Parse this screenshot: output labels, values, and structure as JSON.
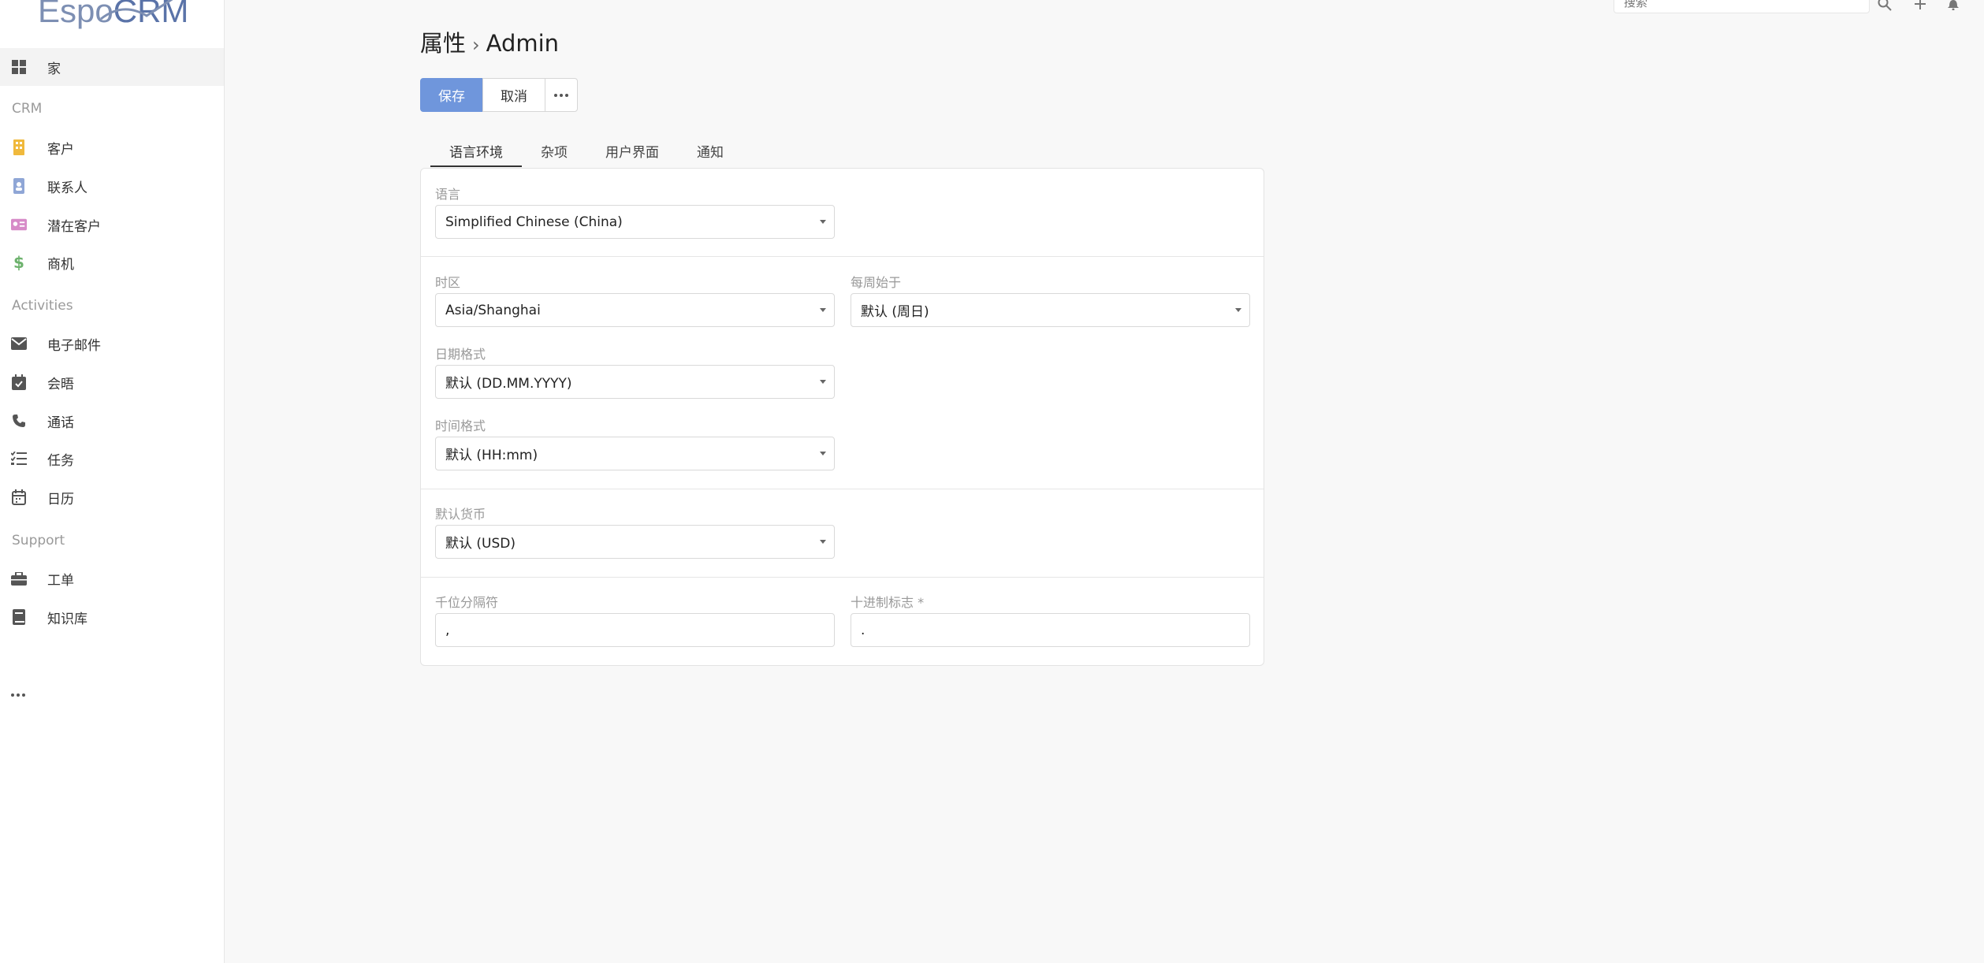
{
  "app": {
    "logo_text": "EspoCRM",
    "logo_lead": "Espo",
    "logo_tail": "CRM"
  },
  "sidebar": {
    "home": "家",
    "groups": {
      "crm": "CRM",
      "activities": "Activities",
      "support": "Support"
    },
    "items": {
      "accounts": "客户",
      "contacts": "联系人",
      "leads": "潜在客户",
      "opportunities": "商机",
      "emails": "电子邮件",
      "meetings": "会晤",
      "calls": "通话",
      "tasks": "任务",
      "calendar": "日历",
      "cases": "工单",
      "knowledge_base": "知识库"
    },
    "icon_colors": {
      "accounts": "#f0b93c",
      "contacts": "#8fa6d6",
      "leads": "#d78bc8",
      "opportunities": "#6db26d"
    }
  },
  "topbar": {
    "search_placeholder": "搜索"
  },
  "header": {
    "section": "属性",
    "separator": "›",
    "record": "Admin"
  },
  "buttons": {
    "save": "保存",
    "cancel": "取消"
  },
  "tabs": [
    {
      "label": "语言环境",
      "active": true
    },
    {
      "label": "杂项",
      "active": false
    },
    {
      "label": "用户界面",
      "active": false
    },
    {
      "label": "通知",
      "active": false
    }
  ],
  "form": {
    "language": {
      "label": "语言",
      "value": "Simplified Chinese (China)"
    },
    "timezone": {
      "label": "时区",
      "value": "Asia/Shanghai"
    },
    "week_start": {
      "label": "每周始于",
      "value": "默认 (周日)"
    },
    "date_format": {
      "label": "日期格式",
      "value": "默认 (DD.MM.YYYY)"
    },
    "time_format": {
      "label": "时间格式",
      "value": "默认 (HH:mm)"
    },
    "currency": {
      "label": "默认货币",
      "value": "默认 (USD)"
    },
    "thousand_separator": {
      "label": "千位分隔符",
      "value": ","
    },
    "decimal_mark": {
      "label": "十进制标志 *",
      "value": "."
    }
  },
  "colors": {
    "primary": "#6f96dc",
    "background": "#f8f8f8"
  }
}
